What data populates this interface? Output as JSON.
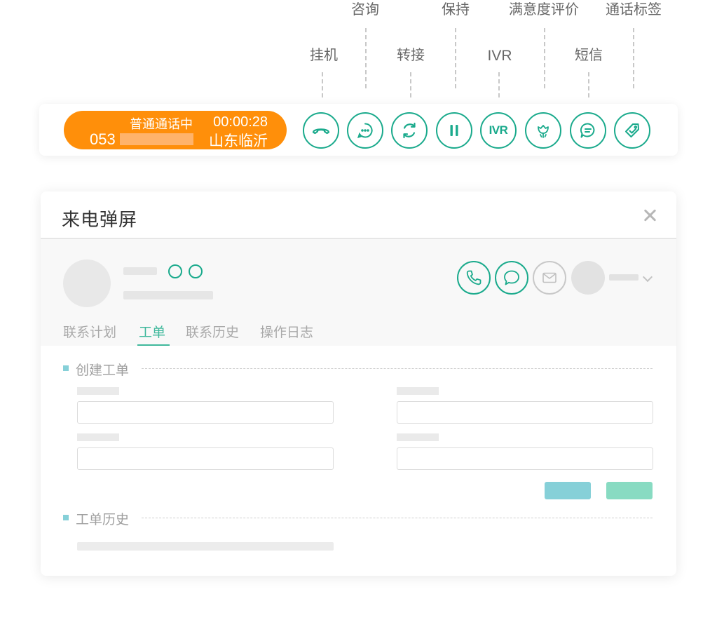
{
  "callouts": {
    "hangup": "挂机",
    "consult": "咨询",
    "transfer": "转接",
    "hold": "保持",
    "ivr": "IVR",
    "satisfaction": "满意度评价",
    "sms": "短信",
    "call_tag": "通话标签"
  },
  "call_bar": {
    "status": "普通通话中",
    "timer": "00:00:28",
    "number_prefix": "053",
    "region": "山东临沂",
    "ivr_button_text": "IVR"
  },
  "icons": {
    "hangup": "phone-hangup-icon",
    "consult": "chat-dots-icon",
    "transfer": "refresh-arrows-icon",
    "hold": "pause-icon",
    "satisfaction": "flower-icon",
    "sms": "message-icon",
    "call_tag": "tag-icon"
  },
  "popup": {
    "title": "来电弹屏",
    "tabs": [
      "联系计划",
      "工单",
      "联系历史",
      "操作日志"
    ],
    "active_tab": "工单",
    "sections": {
      "create_ticket": "创建工单",
      "ticket_history": "工单历史"
    }
  },
  "colors": {
    "accent_orange": "#ff8f0a",
    "accent_green": "#1aaa8c",
    "button_teal": "#86d0d8",
    "button_mint": "#88dbc2"
  }
}
